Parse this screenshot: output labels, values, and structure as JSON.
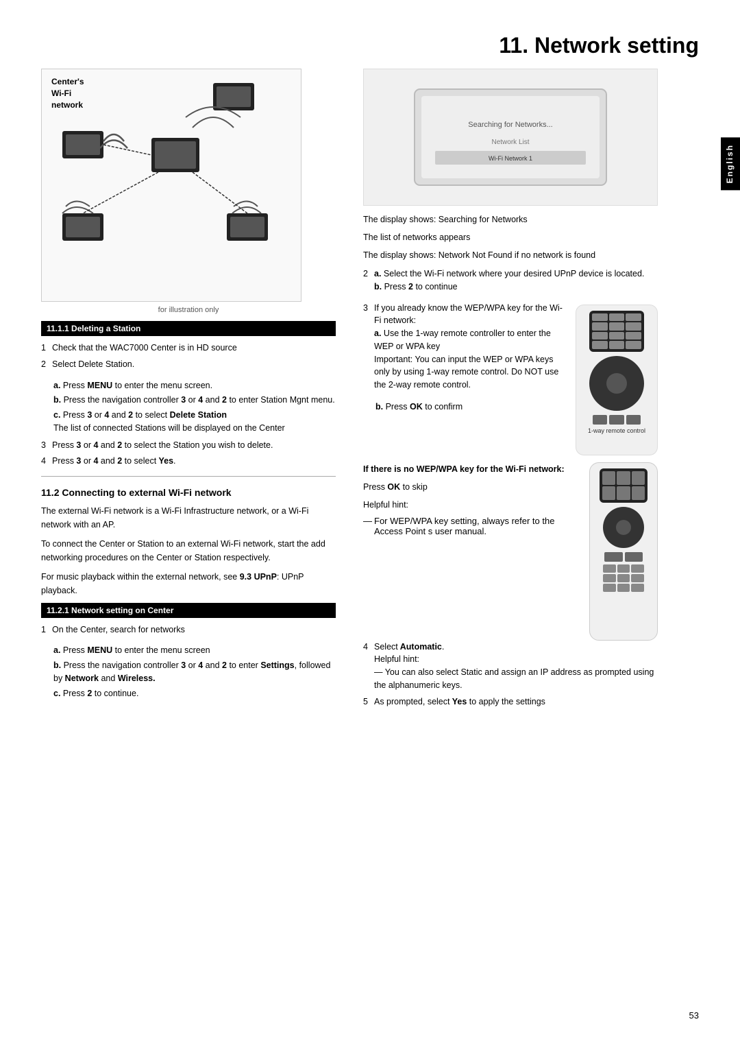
{
  "page": {
    "title": "11. Network setting",
    "number": "53",
    "language_tab": "English"
  },
  "diagram": {
    "label_line1": "Center's",
    "label_line2": "Wi-Fi",
    "label_line3": "network",
    "illustration_text": "for illustration only"
  },
  "section_1111": {
    "header": "11.1.1 Deleting a Station",
    "steps": [
      {
        "num": "1",
        "text": "Check that the WAC7000 Center is in HD source"
      },
      {
        "num": "2",
        "text": "Select Delete Station."
      }
    ],
    "step2_subs": [
      {
        "label": "a.",
        "text": "Press MENU to enter the menu screen."
      },
      {
        "label": "b.",
        "text": "Press the navigation controller 3 or 4  and 2 to enter Station Mgnt menu."
      },
      {
        "label": "c.",
        "text": "Press 3 or 4 and 2 to select Delete Station",
        "extra": "The list of connected Stations will be displayed on the Center"
      }
    ],
    "step3": "Press 3 or 4  and 2 to select the Station you wish to delete.",
    "step4": "Press 3 or 4  and 2 to select Yes."
  },
  "section_112": {
    "title": "11.2 Connecting to external Wi-Fi network",
    "body1": "The external Wi-Fi network is a Wi-Fi Infrastructure network, or a Wi-Fi network with an AP.",
    "body2": "To connect the Center or Station to an external Wi-Fi network, start the add networking procedures on the Center or Station respectively.",
    "body3": "For music playback within the external network, see 9.3 UPnP: UPnP playback."
  },
  "section_1121": {
    "header": "11.2.1 Network setting on Center",
    "steps": [
      {
        "num": "1",
        "text": "On the Center, search for networks"
      }
    ],
    "step1_subs": [
      {
        "label": "a.",
        "text": "Press MENU to enter the menu screen"
      },
      {
        "label": "b.",
        "text": "Press the navigation controller 3 or 4  and 2 to enter Settings, followed by Network and Wireless."
      },
      {
        "label": "c.",
        "text": "Press 2 to continue."
      }
    ]
  },
  "right_column": {
    "display_text1": "The display shows: Searching for Networks",
    "display_text2": "The list of networks appears",
    "display_text3": "The display shows: Network Not Found if no network is found",
    "step2": {
      "num": "2",
      "label_a": "a.",
      "text_a": "Select the Wi-Fi network where your desired UPnP device is located.",
      "label_b": "b.",
      "text_b": "Press 2 to continue"
    },
    "step3": {
      "num": "3",
      "text": "If you already know the WEP/WPA key for the Wi-Fi network:",
      "sub_a_label": "a.",
      "sub_a_text": "Use the 1-way remote controller to enter the WEP or WPA key",
      "sub_a_note": "Important:  You can input the WEP or WPA keys only by using 1-way remote control. Do NOT use the 2-way remote control.",
      "sub_b_label": "b.",
      "sub_b_text": "Press OK to confirm",
      "remote_label": "1-way remote control"
    },
    "no_wep_header": "If there is no WEP/WPA key for the Wi-Fi network:",
    "no_wep_text": "Press OK to skip",
    "helpful_hint_label": "Helpful hint:",
    "helpful_hint_text": "— For WEP/WPA key setting, always refer to the Access Point s user manual.",
    "step4": {
      "num": "4",
      "text": "Select Automatic.",
      "hint_label": "Helpful hint:",
      "hint_dash": "—",
      "hint_text": "You can also select Static and assign an IP address as prompted using the alphanumeric keys."
    },
    "step5": {
      "num": "5",
      "text": "As prompted, select Yes to apply the settings"
    }
  }
}
